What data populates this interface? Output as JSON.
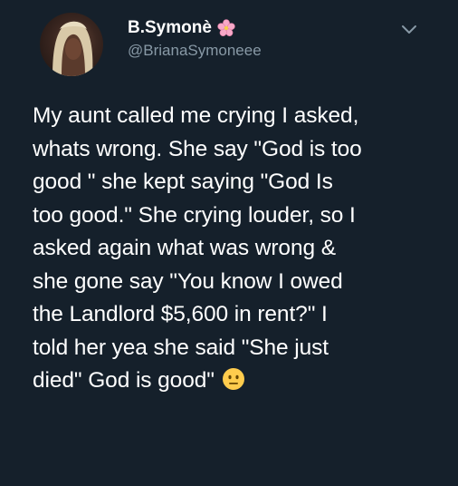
{
  "user": {
    "display_name": "B.Symonè",
    "handle": "@BrianaSymoneee",
    "name_badge_icon": "cherry-blossom-icon",
    "avatar_icon": "profile-photo"
  },
  "menu": {
    "icon": "chevron-down-icon"
  },
  "tweet": {
    "lines": [
      "My aunt called me crying I asked,",
      "whats wrong.  She say \"God is too",
      "good \" she kept saying \"God Is",
      "too good.\" She crying louder, so I",
      "asked again what was wrong &",
      "she gone say \"You know I owed",
      "the Landlord $5,600 in rent?\" I",
      "told her yea she said \"She just",
      "died\" God is good\""
    ],
    "trailing_emoji": "neutral-face-emoji-icon"
  },
  "colors": {
    "background": "#15202b",
    "text": "#ffffff",
    "secondary": "#8899a6"
  }
}
